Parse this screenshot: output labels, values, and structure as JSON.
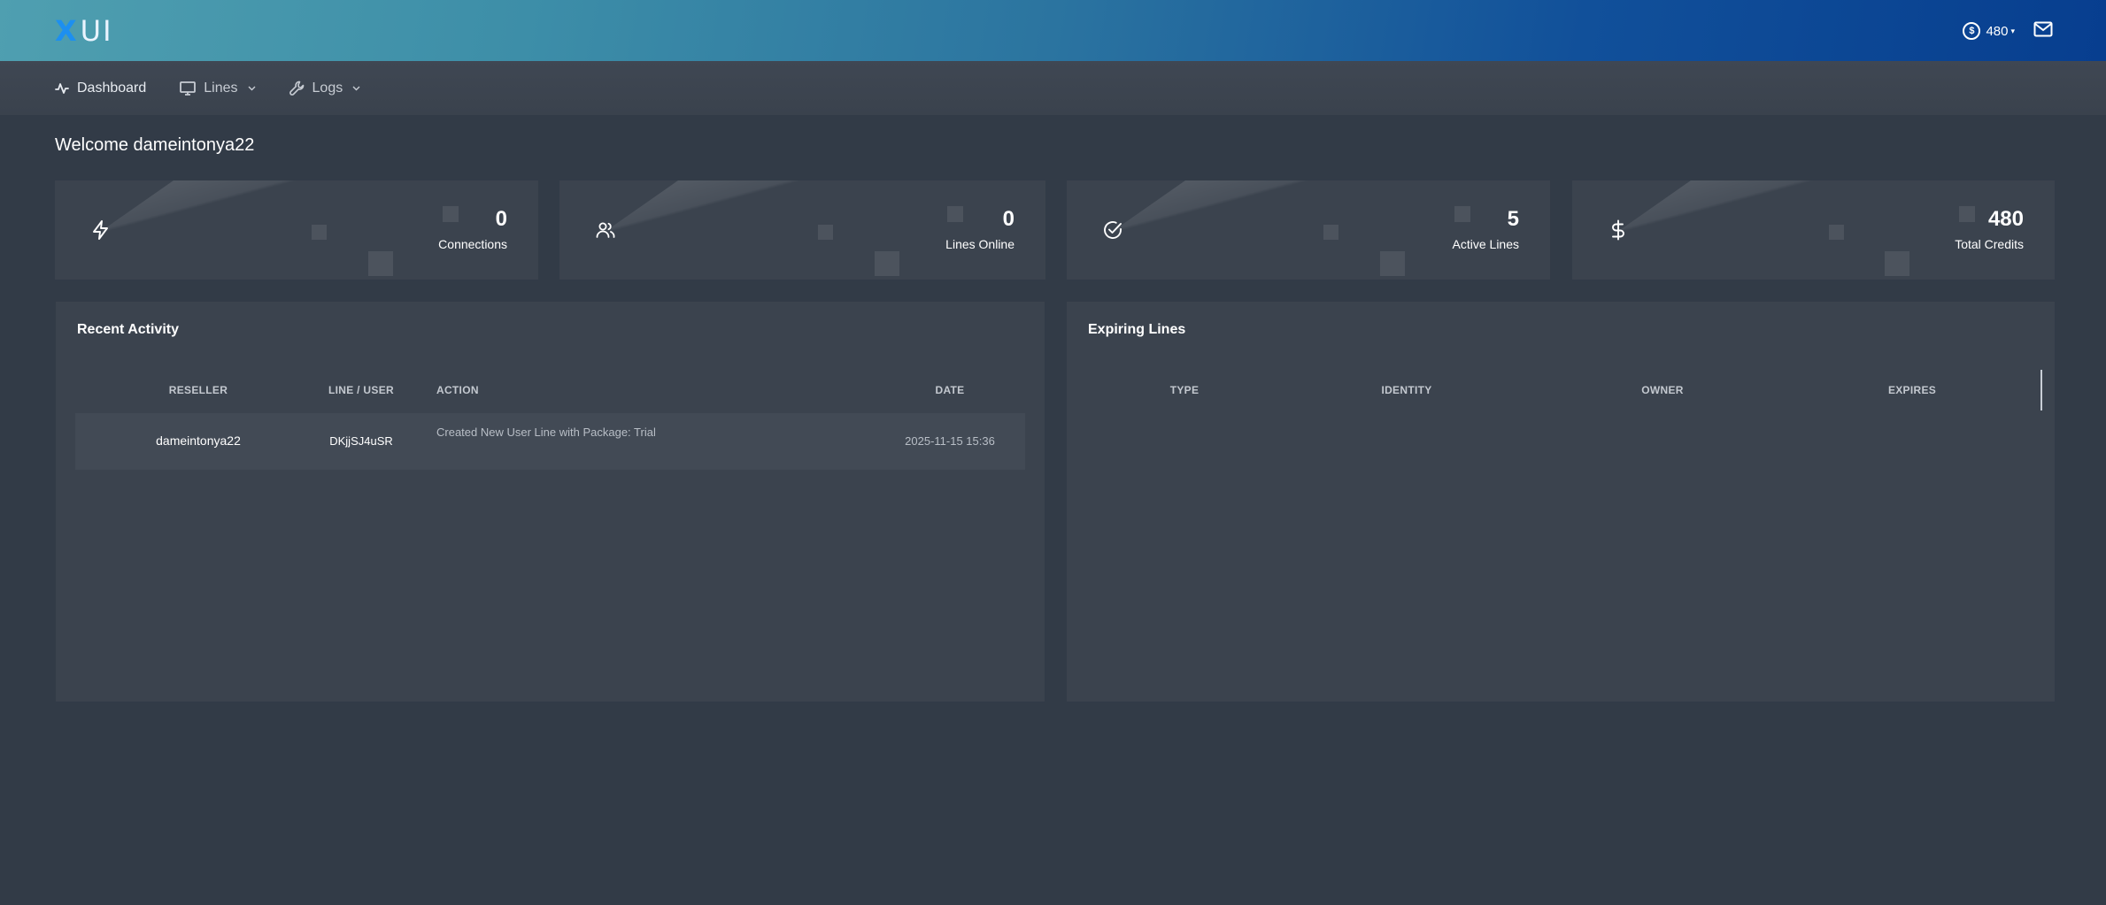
{
  "header": {
    "logo_mark": "X",
    "logo_text": "UI",
    "credits": "480"
  },
  "nav": {
    "dashboard": "Dashboard",
    "lines": "Lines",
    "logs": "Logs"
  },
  "welcome": "Welcome dameintonya22",
  "stats": [
    {
      "value": "0",
      "label": "Connections",
      "icon": "bolt-icon"
    },
    {
      "value": "0",
      "label": "Lines Online",
      "icon": "users-icon"
    },
    {
      "value": "5",
      "label": "Active Lines",
      "icon": "check-circle-icon"
    },
    {
      "value": "480",
      "label": "Total Credits",
      "icon": "dollar-icon"
    }
  ],
  "recent_activity": {
    "title": "Recent Activity",
    "columns": [
      "RESELLER",
      "LINE / USER",
      "ACTION",
      "DATE"
    ],
    "rows": [
      {
        "reseller": "dameintonya22",
        "line_user": "DKjjSJ4uSR",
        "action": "Created New User Line with Package: Trial",
        "date": "2025-11-15 15:36"
      }
    ]
  },
  "expiring_lines": {
    "title": "Expiring Lines",
    "columns": [
      "TYPE",
      "IDENTITY",
      "OWNER",
      "EXPIRES"
    ]
  }
}
